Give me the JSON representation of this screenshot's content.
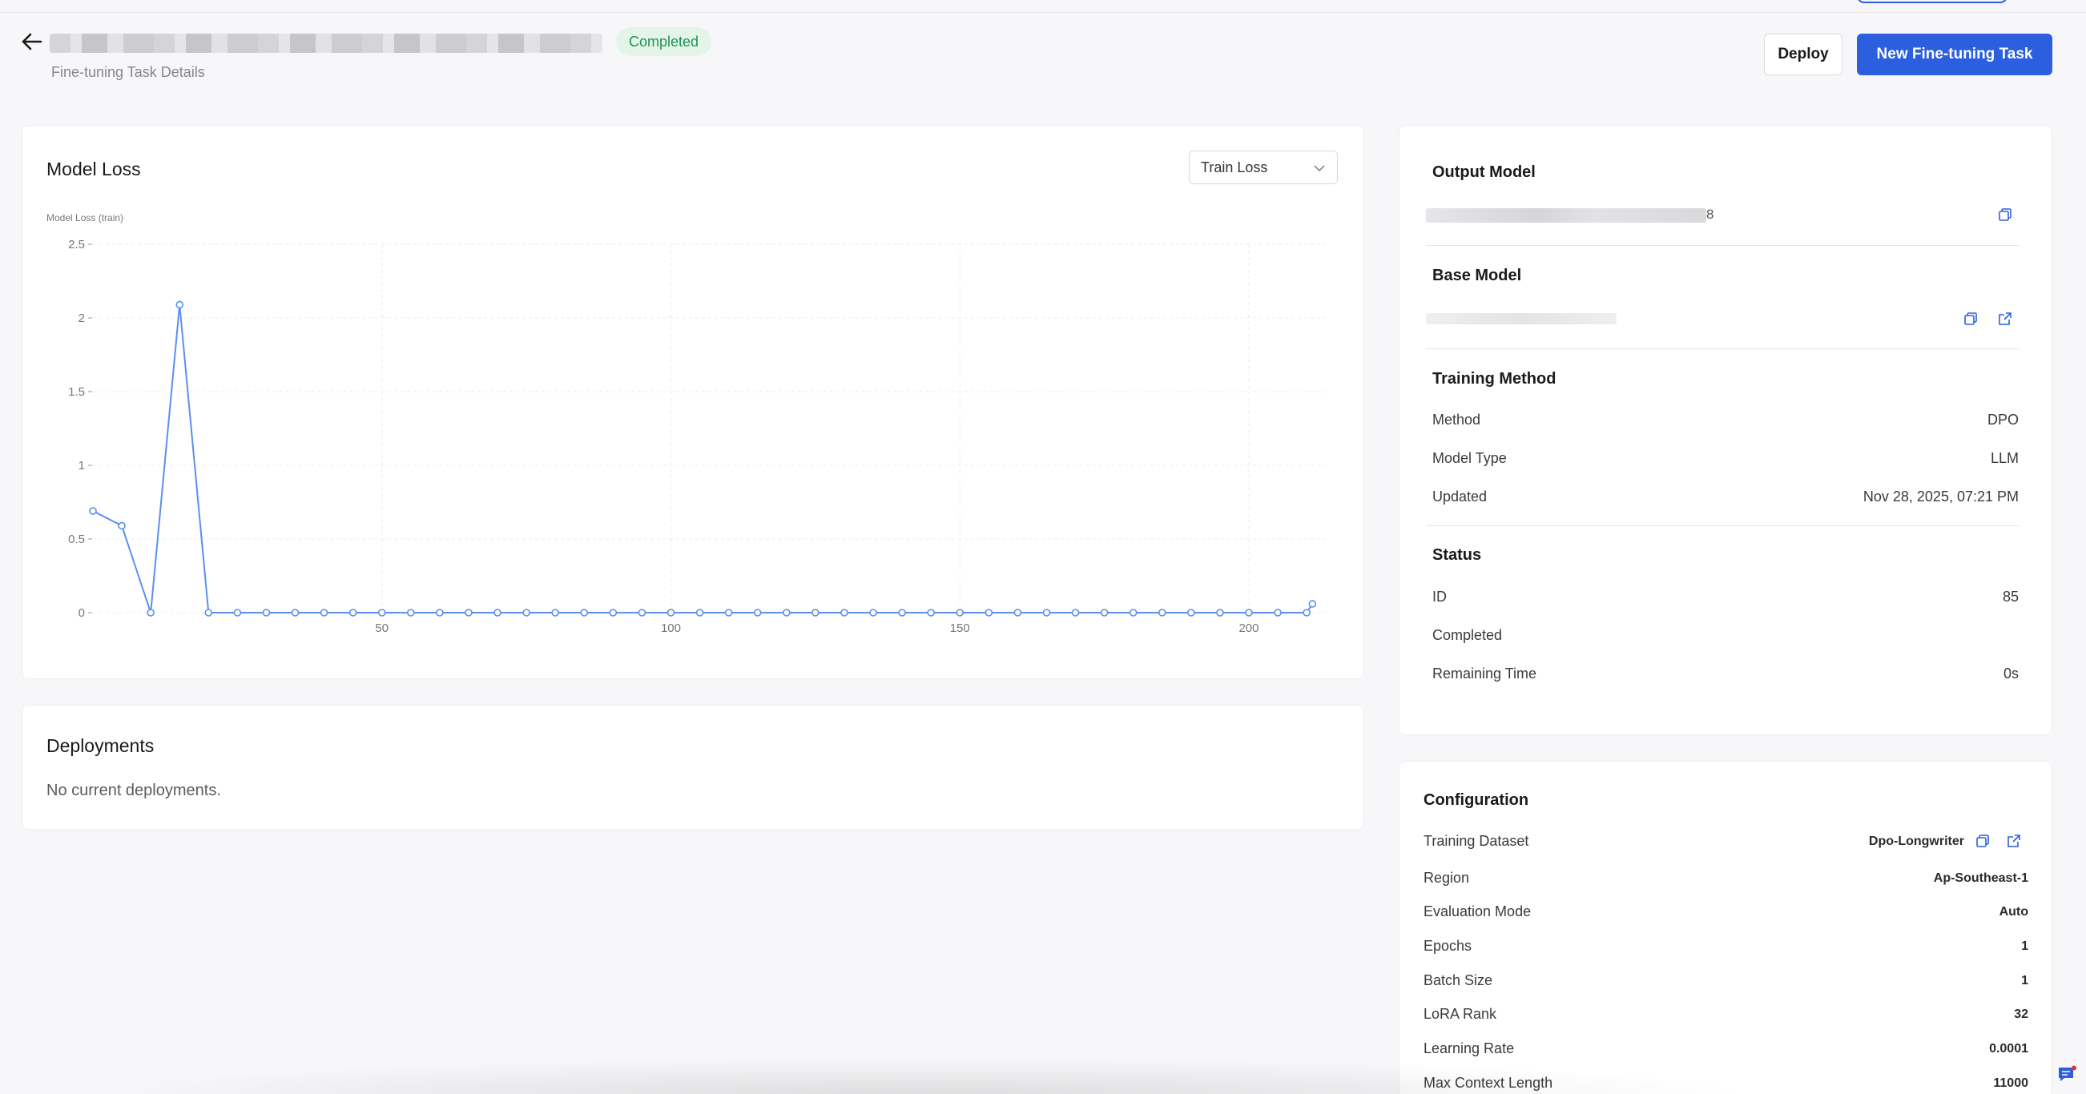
{
  "header": {
    "status": "Completed",
    "subtitle": "Fine-tuning Task Details",
    "deploy_label": "Deploy",
    "new_task_label": "New Fine-tuning Task"
  },
  "loss_panel": {
    "title": "Model Loss",
    "select_value": "Train Loss"
  },
  "chart_data": {
    "type": "line",
    "ylabel": "Model Loss (train)",
    "xlim": [
      0,
      214
    ],
    "ylim": [
      0,
      2.5
    ],
    "y_ticks": [
      "0",
      "0.5",
      "1",
      "1.5",
      "2",
      "2.5"
    ],
    "x_ticks": [
      "50",
      "100",
      "150",
      "200"
    ],
    "grid": true,
    "series": [
      {
        "color": "#5b8ff0",
        "x": [
          0,
          5,
          10,
          15,
          20,
          25,
          30,
          35,
          40,
          45,
          50,
          55,
          60,
          65,
          70,
          75,
          80,
          85,
          90,
          95,
          100,
          105,
          110,
          115,
          120,
          125,
          130,
          135,
          140,
          145,
          150,
          155,
          160,
          165,
          170,
          175,
          180,
          185,
          190,
          195,
          200,
          205,
          210,
          211
        ],
        "y": [
          0.69,
          0.59,
          0.0,
          2.09,
          0.0,
          0.0,
          0.0,
          0.0,
          0.0,
          0.0,
          0.0,
          0.0,
          0.0,
          0.0,
          0.0,
          0.0,
          0.0,
          0.0,
          0.0,
          0.0,
          0.0,
          0.0,
          0.0,
          0.0,
          0.0,
          0.0,
          0.0,
          0.0,
          0.0,
          0.0,
          0.0,
          0.0,
          0.0,
          0.0,
          0.0,
          0.0,
          0.0,
          0.0,
          0.0,
          0.0,
          0.0,
          0.0,
          0.0,
          0.06
        ]
      }
    ]
  },
  "deployments": {
    "title": "Deployments",
    "empty_text": "No current deployments."
  },
  "info": {
    "output_model_title": "Output Model",
    "output_model_suffix": "8",
    "base_model_title": "Base Model",
    "training_method_title": "Training Method",
    "method_label": "Method",
    "method_value": "DPO",
    "model_type_label": "Model Type",
    "model_type_value": "LLM",
    "updated_label": "Updated",
    "updated_value": "Nov 28, 2025, 07:21 PM",
    "status_title": "Status",
    "id_label": "ID",
    "id_value": "85",
    "completed_label": "Completed",
    "remaining_label": "Remaining Time",
    "remaining_value": "0s"
  },
  "config": {
    "title": "Configuration",
    "rows": [
      {
        "label": "Training Dataset",
        "value": "Dpo-Longwriter"
      },
      {
        "label": "Region",
        "value": "Ap-Southeast-1"
      },
      {
        "label": "Evaluation Mode",
        "value": "Auto"
      },
      {
        "label": "Epochs",
        "value": "1"
      },
      {
        "label": "Batch Size",
        "value": "1"
      },
      {
        "label": "LoRA Rank",
        "value": "32"
      },
      {
        "label": "Learning Rate",
        "value": "0.0001"
      },
      {
        "label": "Max Context Length",
        "value": "11000"
      }
    ]
  },
  "colors": {
    "accent": "#2c5fe0",
    "status_bg": "#e3f5e9",
    "status_text": "#229153",
    "line": "#5b8ff0"
  }
}
